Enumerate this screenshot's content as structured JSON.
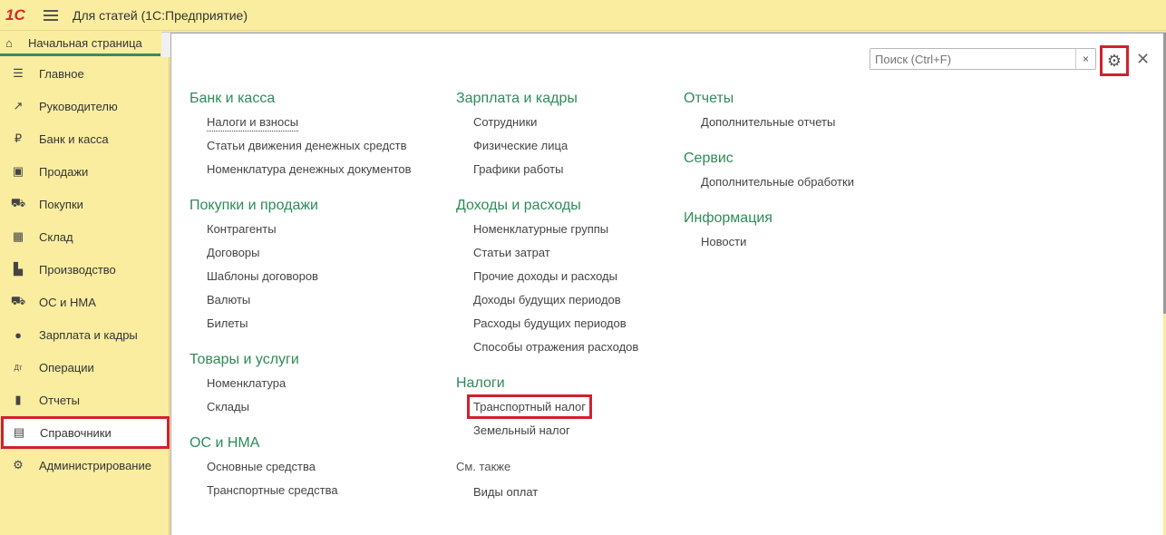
{
  "app": {
    "logo": "1С",
    "title": "Для статей  (1С:Предприятие)"
  },
  "home_tab": "Начальная страница",
  "sidebar": {
    "items": [
      {
        "label": "Главное",
        "icon": "menu-icon",
        "glyph": "☰"
      },
      {
        "label": "Руководителю",
        "icon": "trend-icon",
        "glyph": "↗"
      },
      {
        "label": "Банк и касса",
        "icon": "ruble-icon",
        "glyph": "₽"
      },
      {
        "label": "Продажи",
        "icon": "bag-icon",
        "glyph": "▣"
      },
      {
        "label": "Покупки",
        "icon": "cart-icon",
        "glyph": "⛟"
      },
      {
        "label": "Склад",
        "icon": "warehouse-icon",
        "glyph": "▦"
      },
      {
        "label": "Производство",
        "icon": "factory-icon",
        "glyph": "▙"
      },
      {
        "label": "ОС и НМА",
        "icon": "truck-icon",
        "glyph": "⛟"
      },
      {
        "label": "Зарплата и кадры",
        "icon": "person-icon",
        "glyph": "●"
      },
      {
        "label": "Операции",
        "icon": "dt-kt-icon",
        "glyph": "Дт"
      },
      {
        "label": "Отчеты",
        "icon": "bar-chart-icon",
        "glyph": "▮"
      },
      {
        "label": "Справочники",
        "icon": "books-icon",
        "glyph": "▤"
      },
      {
        "label": "Администрирование",
        "icon": "gear-icon",
        "glyph": "⚙"
      }
    ],
    "selected": "Справочники"
  },
  "search": {
    "placeholder": "Поиск (Ctrl+F)",
    "clear": "×"
  },
  "close": "✕",
  "col1": [
    {
      "title": "Банк и касса",
      "items": [
        "Налоги и взносы",
        "Статьи движения денежных средств",
        "Номенклатура денежных документов"
      ]
    },
    {
      "title": "Покупки и продажи",
      "items": [
        "Контрагенты",
        "Договоры",
        "Шаблоны договоров",
        "Валюты",
        "Билеты"
      ]
    },
    {
      "title": "Товары и услуги",
      "items": [
        "Номенклатура",
        "Склады"
      ]
    },
    {
      "title": "ОС и НМА",
      "items": [
        "Основные средства",
        "Транспортные средства"
      ]
    }
  ],
  "col2": [
    {
      "title": "Зарплата и кадры",
      "items": [
        "Сотрудники",
        "Физические лица",
        "Графики работы"
      ]
    },
    {
      "title": "Доходы и расходы",
      "items": [
        "Номенклатурные группы",
        "Статьи затрат",
        "Прочие доходы и расходы",
        "Доходы будущих периодов",
        "Расходы будущих периодов",
        "Способы отражения расходов"
      ]
    },
    {
      "title": "Налоги",
      "items": [
        "Транспортный налог",
        "Земельный налог"
      ]
    }
  ],
  "see_also": {
    "title": "См. также",
    "items": [
      "Виды оплат"
    ]
  },
  "col3": [
    {
      "title": "Отчеты",
      "items": [
        "Дополнительные отчеты"
      ]
    },
    {
      "title": "Сервис",
      "items": [
        "Дополнительные обработки"
      ]
    },
    {
      "title": "Информация",
      "items": [
        "Новости"
      ]
    }
  ],
  "colors": {
    "accent": "#2e8b57",
    "highlight": "#d0212e",
    "panel": "#fbeda0"
  }
}
